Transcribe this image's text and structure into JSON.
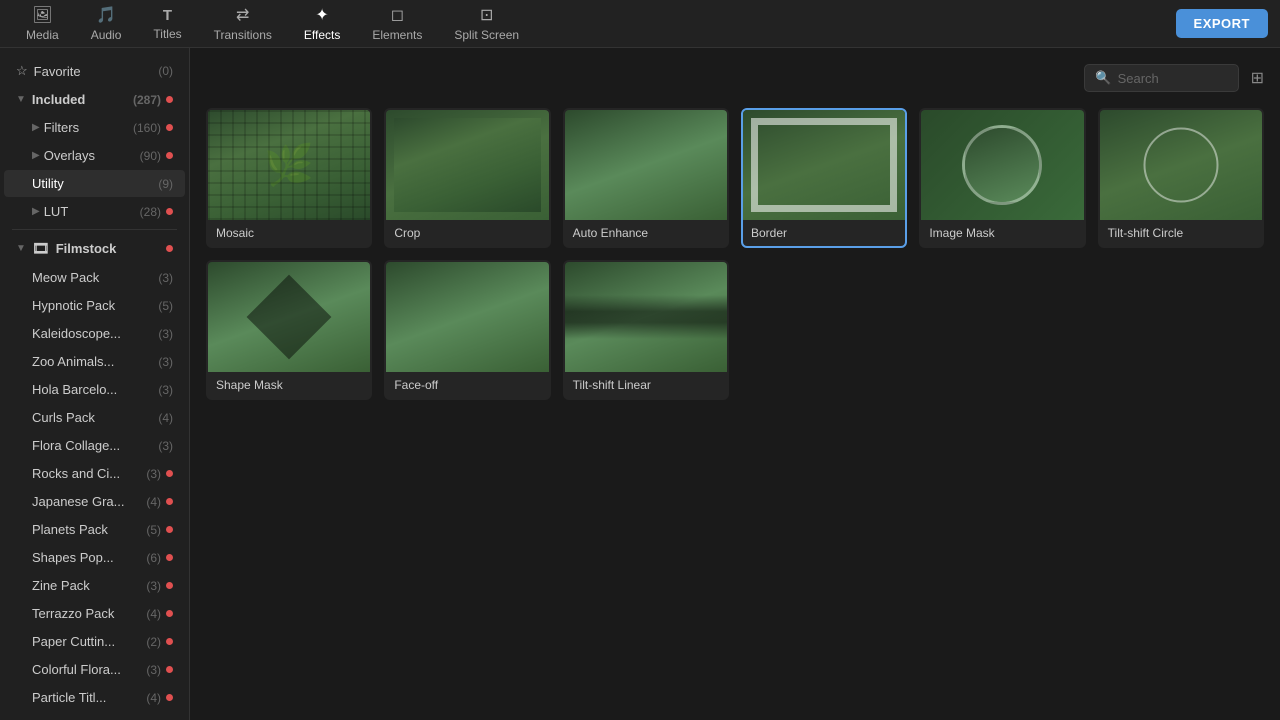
{
  "nav": {
    "items": [
      {
        "id": "media",
        "label": "Media",
        "icon": "🖼"
      },
      {
        "id": "audio",
        "label": "Audio",
        "icon": "🎵"
      },
      {
        "id": "titles",
        "label": "Titles",
        "icon": "T"
      },
      {
        "id": "transitions",
        "label": "Transitions",
        "icon": "⇄"
      },
      {
        "id": "effects",
        "label": "Effects",
        "icon": "✦"
      },
      {
        "id": "elements",
        "label": "Elements",
        "icon": "◻"
      },
      {
        "id": "split_screen",
        "label": "Split Screen",
        "icon": "⊡"
      }
    ],
    "export_label": "EXPORT"
  },
  "sidebar": {
    "favorite": {
      "label": "Favorite",
      "count": "(0)"
    },
    "included": {
      "label": "Included",
      "count": "(287)"
    },
    "sub_items": [
      {
        "id": "filters",
        "label": "Filters",
        "count": "(160)",
        "has_dot": true
      },
      {
        "id": "overlays",
        "label": "Overlays",
        "count": "(90)",
        "has_dot": true
      },
      {
        "id": "utility",
        "label": "Utility",
        "count": "(9)",
        "active": true
      },
      {
        "id": "lut",
        "label": "LUT",
        "count": "(28)",
        "has_dot": true
      }
    ],
    "filmstock": {
      "label": "Filmstock",
      "packs": [
        {
          "id": "meow_pack",
          "label": "Meow Pack",
          "count": "(3)"
        },
        {
          "id": "hypnotic_pack",
          "label": "Hypnotic Pack",
          "count": "(5)"
        },
        {
          "id": "kaleidoscope",
          "label": "Kaleidoscope...",
          "count": "(3)"
        },
        {
          "id": "zoo_animals",
          "label": "Zoo Animals...",
          "count": "(3)"
        },
        {
          "id": "hola_barcelo",
          "label": "Hola Barcelo...",
          "count": "(3)"
        },
        {
          "id": "curls_pack",
          "label": "Curls Pack",
          "count": "(4)"
        },
        {
          "id": "flora_collage",
          "label": "Flora Collage...",
          "count": "(3)"
        },
        {
          "id": "rocks_and_ci",
          "label": "Rocks and Ci...",
          "count": "(3)",
          "has_dot": true
        },
        {
          "id": "japanese_gra",
          "label": "Japanese Gra...",
          "count": "(4)",
          "has_dot": true
        },
        {
          "id": "planets_pack",
          "label": "Planets Pack",
          "count": "(5)",
          "has_dot": true
        },
        {
          "id": "shapes_pop",
          "label": "Shapes Pop...",
          "count": "(6)",
          "has_dot": true
        },
        {
          "id": "zine_pack",
          "label": "Zine Pack",
          "count": "(3)",
          "has_dot": true
        },
        {
          "id": "terrazzo_pack",
          "label": "Terrazzo Pack",
          "count": "(4)",
          "has_dot": true
        },
        {
          "id": "paper_cuttin",
          "label": "Paper Cuttin...",
          "count": "(2)",
          "has_dot": true
        },
        {
          "id": "colorful_flora",
          "label": "Colorful Flora...",
          "count": "(3)",
          "has_dot": true
        },
        {
          "id": "particle_titl",
          "label": "Particle Titl...",
          "count": "(4)",
          "has_dot": true
        }
      ]
    }
  },
  "search": {
    "placeholder": "Search"
  },
  "effects": [
    {
      "id": "mosaic",
      "label": "Mosaic",
      "thumb": "mosaic"
    },
    {
      "id": "crop",
      "label": "Crop",
      "thumb": "crop"
    },
    {
      "id": "auto_enhance",
      "label": "Auto Enhance",
      "thumb": "auto"
    },
    {
      "id": "border",
      "label": "Border",
      "thumb": "border",
      "selected": true
    },
    {
      "id": "image_mask",
      "label": "Image Mask",
      "thumb": "image-mask"
    },
    {
      "id": "tiltshift_circle",
      "label": "Tilt-shift Circle",
      "thumb": "tiltshift-circle"
    },
    {
      "id": "shape_mask",
      "label": "Shape Mask",
      "thumb": "shape-mask"
    },
    {
      "id": "faceoff",
      "label": "Face-off",
      "thumb": "faceoff"
    },
    {
      "id": "tiltshift_linear",
      "label": "Tilt-shift Linear",
      "thumb": "tiltshift-linear"
    }
  ]
}
